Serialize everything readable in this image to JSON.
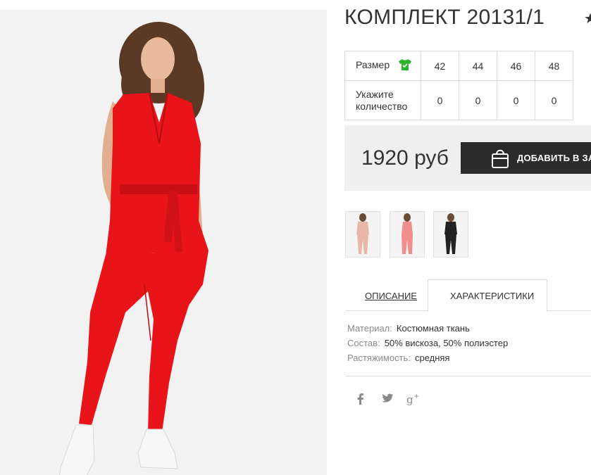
{
  "product": {
    "title": "КОМПЛЕКТ 20131/1",
    "favorite_icon": "star-icon",
    "image_alt": "red-suit-photo"
  },
  "size_table": {
    "size_label": "Размер",
    "size_icon": "size-chart-shirt-icon",
    "sizes": [
      "42",
      "44",
      "46",
      "48"
    ],
    "quantity_label_line1": "Укажите",
    "quantity_label_line2": "количество",
    "quantities": [
      "0",
      "0",
      "0",
      "0"
    ]
  },
  "buy": {
    "price": "1920 руб",
    "add_button_label": "ДОБАВИТЬ В ЗАКАЗ",
    "bag_icon": "shopping-bag-icon"
  },
  "thumbnails": [
    {
      "name": "thumb-pink-suit",
      "color": "#e8b7a8"
    },
    {
      "name": "thumb-pink-jumpsuit",
      "color": "#ef8e8c"
    },
    {
      "name": "thumb-black-suit",
      "color": "#222222"
    }
  ],
  "tabs": {
    "description": "ОПИСАНИЕ",
    "characteristics": "ХАРАКТЕРИСТИКИ",
    "active": "characteristics"
  },
  "specs": [
    {
      "key": "Материал:",
      "value": "Костюмная ткань"
    },
    {
      "key": "Состав:",
      "value": "50% вискоза, 50% полиэстер"
    },
    {
      "key": "Растяжимость:",
      "value": "средняя"
    }
  ],
  "social": [
    "facebook-icon",
    "twitter-icon",
    "google-plus-icon"
  ],
  "colors": {
    "accent_dark": "#2b2b2b",
    "size_icon_green": "#2fb32f",
    "garment_red": "#e8141a"
  }
}
